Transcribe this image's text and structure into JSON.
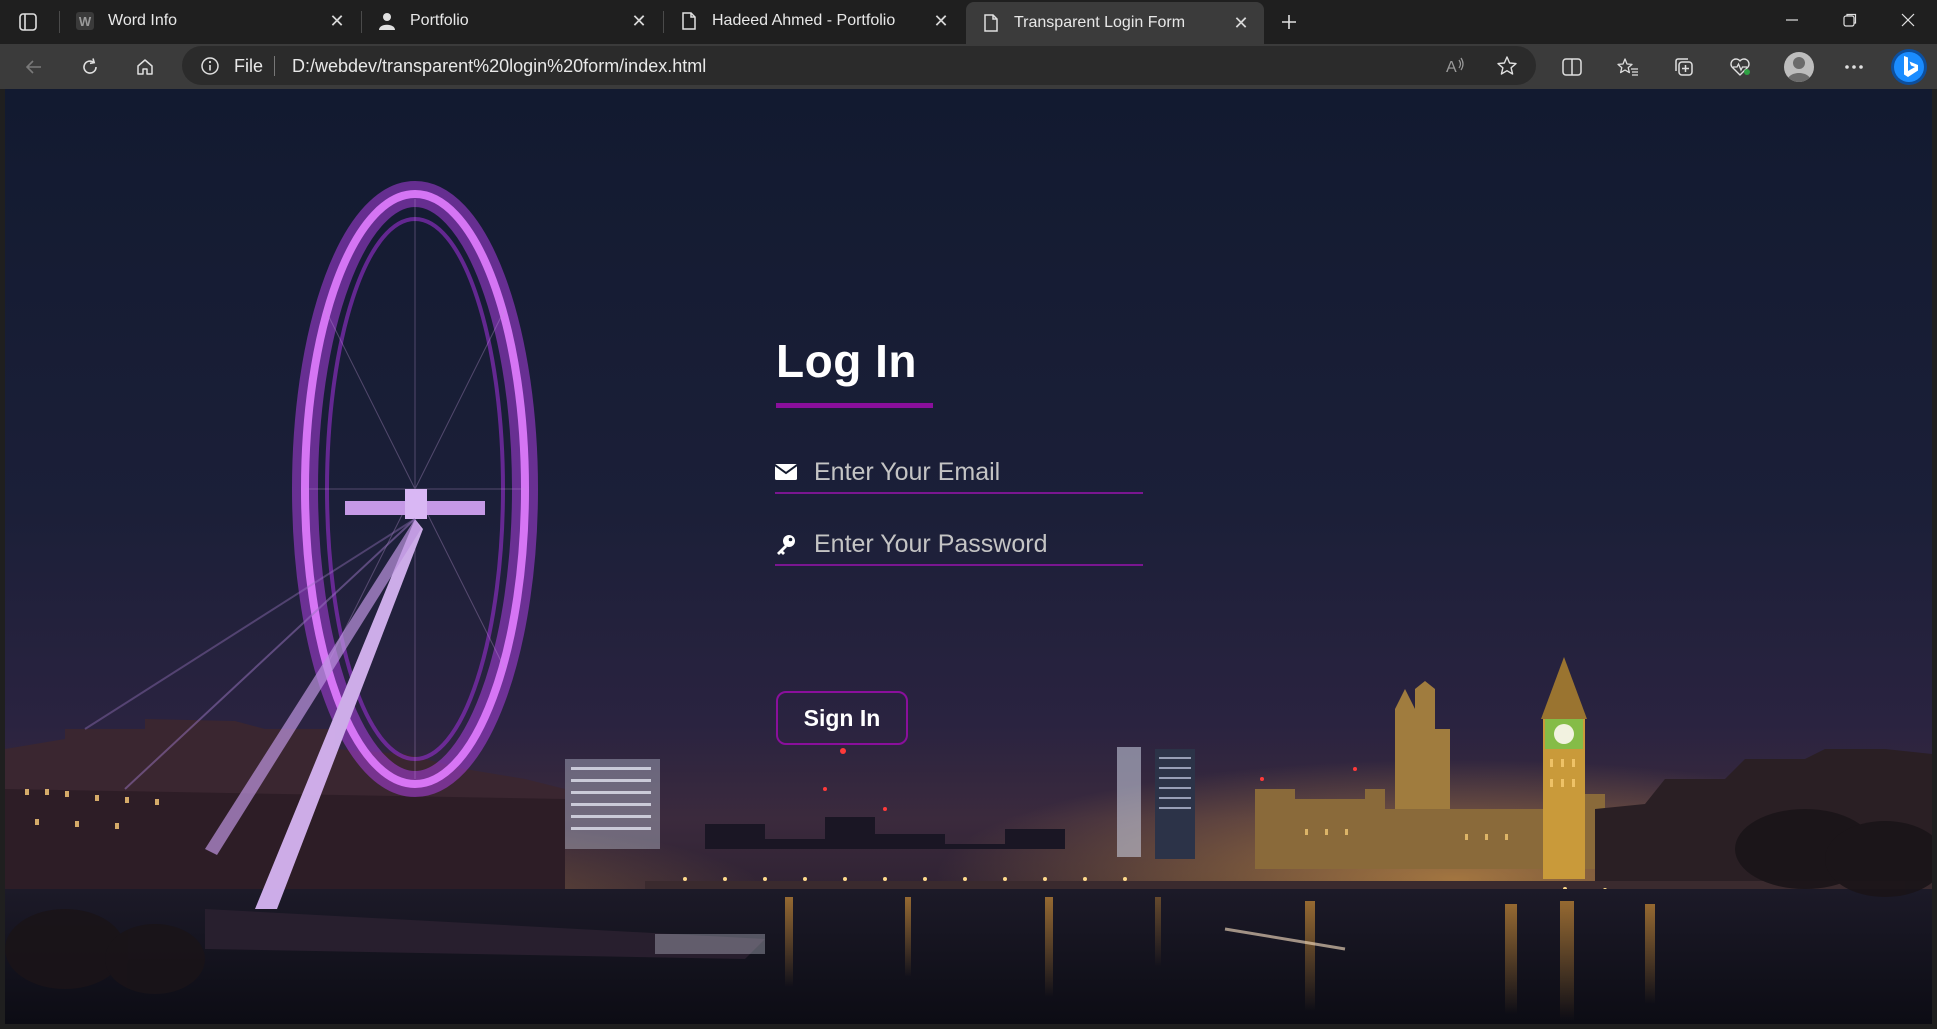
{
  "browser": {
    "tabs": [
      {
        "title": "Word Info",
        "icon": "word-w-icon",
        "active": false
      },
      {
        "title": "Portfolio",
        "icon": "person-icon",
        "active": false
      },
      {
        "title": "Hadeed Ahmed - Portfolio",
        "icon": "page-icon",
        "active": false
      },
      {
        "title": "Transparent Login Form",
        "icon": "page-icon",
        "active": true
      }
    ],
    "address": {
      "scheme_label": "File",
      "url": "D:/webdev/transparent%20login%20form/index.html"
    },
    "colors": {
      "chrome_bg": "#1f1f1f",
      "toolbar_bg": "#3b3b3b",
      "accent": "#1a8cff"
    }
  },
  "page": {
    "title": "Log In",
    "email_placeholder": "Enter Your Email",
    "password_placeholder": "Enter Your Password",
    "button_label": "Sign In",
    "accent_color": "#8a0f9c",
    "background": "night-london-skyline-with-ferris-wheel"
  }
}
